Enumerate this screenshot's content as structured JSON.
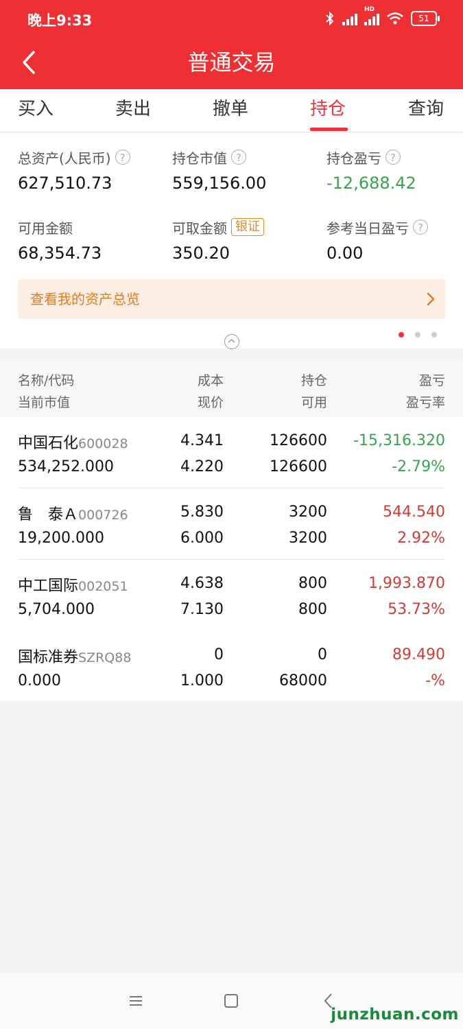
{
  "status_bar": {
    "time": "晚上9:33",
    "signal_tag": "HD",
    "battery": "51"
  },
  "header": {
    "title": "普通交易"
  },
  "tabs": [
    {
      "label": "买入",
      "active": false
    },
    {
      "label": "卖出",
      "active": false
    },
    {
      "label": "撤单",
      "active": false
    },
    {
      "label": "持仓",
      "active": true
    },
    {
      "label": "查询",
      "active": false
    }
  ],
  "summary": {
    "total_assets": {
      "label": "总资产(人民币)",
      "value": "627,510.73"
    },
    "market_value": {
      "label": "持仓市值",
      "value": "559,156.00"
    },
    "position_pl": {
      "label": "持仓盈亏",
      "value": "-12,688.42"
    },
    "available": {
      "label": "可用金额",
      "value": "68,354.73"
    },
    "withdrawable": {
      "label": "可取金额",
      "badge": "银证",
      "value": "350.20"
    },
    "today_pl": {
      "label": "参考当日盈亏",
      "value": "0.00"
    }
  },
  "overview_banner": {
    "text": "查看我的资产总览"
  },
  "table_header": {
    "col1_top": "名称/代码",
    "col1_bottom": "当前市值",
    "col2_top": "成本",
    "col2_bottom": "现价",
    "col3_top": "持仓",
    "col3_bottom": "可用",
    "col4_top": "盈亏",
    "col4_bottom": "盈亏率"
  },
  "holdings": [
    {
      "name": "中国石化",
      "code": "600028",
      "market_value": "534,252.000",
      "cost": "4.341",
      "price": "4.220",
      "position": "126600",
      "available": "126600",
      "pl": "-15,316.320",
      "pl_rate": "-2.79%",
      "pl_color": "#3aa350"
    },
    {
      "name": "鲁　泰Ａ",
      "code": "000726",
      "market_value": "19,200.000",
      "cost": "5.830",
      "price": "6.000",
      "position": "3200",
      "available": "3200",
      "pl": "544.540",
      "pl_rate": "2.92%",
      "pl_color": "#d23a35"
    },
    {
      "name": "中工国际",
      "code": "002051",
      "market_value": "5,704.000",
      "cost": "4.638",
      "price": "7.130",
      "position": "800",
      "available": "800",
      "pl": "1,993.870",
      "pl_rate": "53.73%",
      "pl_color": "#d23a35"
    },
    {
      "name": "国标准券",
      "code": "SZRQ88",
      "market_value": "0.000",
      "cost": "0",
      "price": "1.000",
      "position": "0",
      "available": "68000",
      "pl": "89.490",
      "pl_rate": "-%",
      "pl_color": "#d23a35"
    }
  ],
  "watermark": "junzhuan.com",
  "colors": {
    "brand_red": "#ee2f33",
    "loss_green": "#3aa350",
    "gain_red": "#d23a35",
    "accent_orange": "#e07b26"
  }
}
